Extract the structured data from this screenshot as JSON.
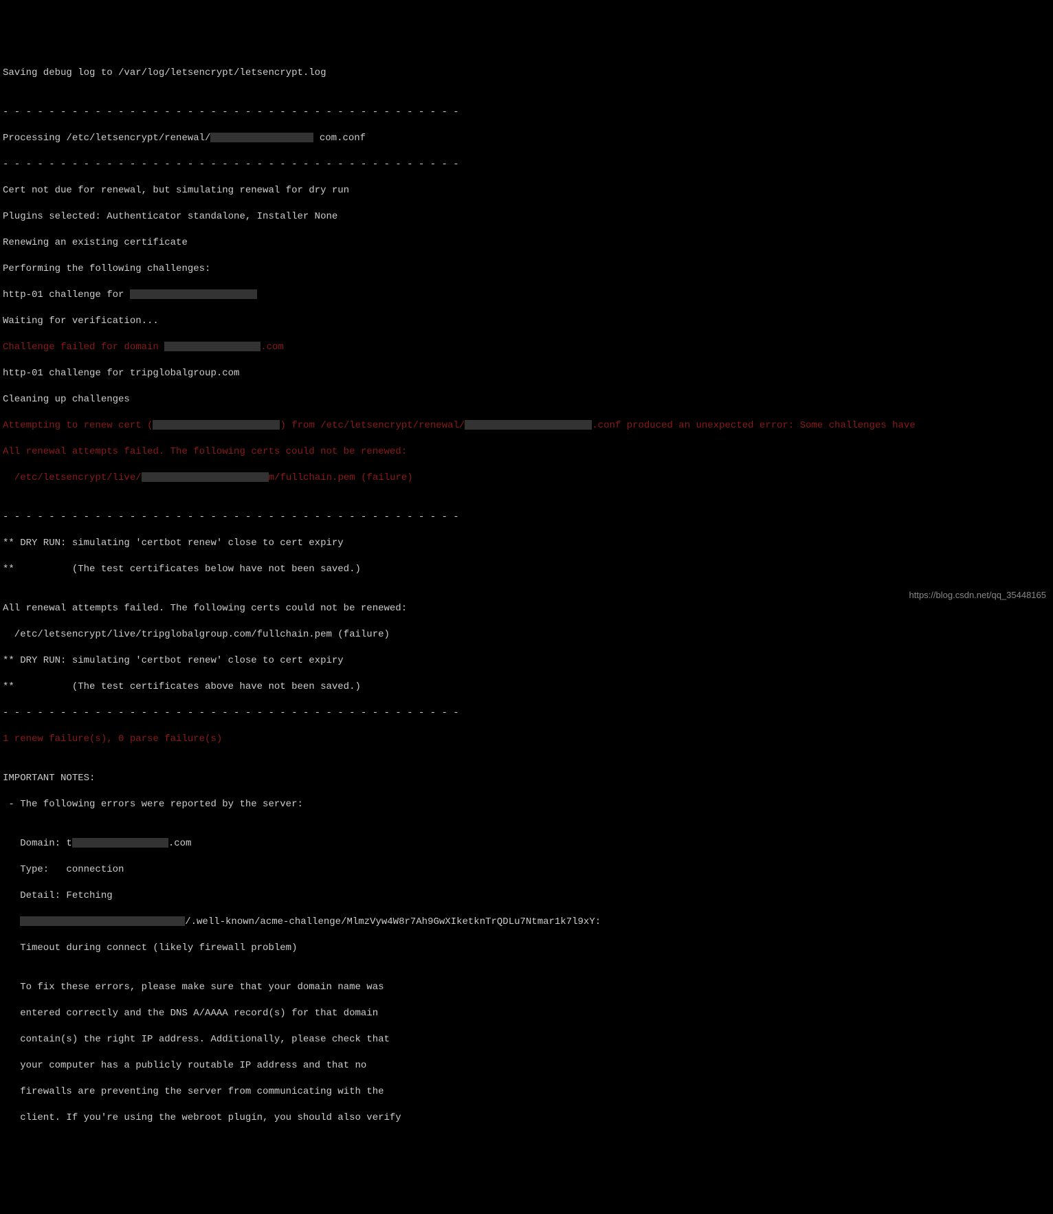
{
  "terminal": {
    "line_01": "Saving debug log to /var/log/letsencrypt/letsencrypt.log",
    "line_02": "",
    "divider": "- - - - - - - - - - - - - - - - - - - - - - - - - - - - - - - - - - - - - - - -",
    "line_04a": "Processing /etc/letsencrypt/renewal/",
    "line_04b": "com.conf",
    "line_06": "Cert not due for renewal, but simulating renewal for dry run",
    "line_07": "Plugins selected: Authenticator standalone, Installer None",
    "line_08": "Renewing an existing certificate",
    "line_09": "Performing the following challenges:",
    "line_10a": "http-01 challenge for ",
    "line_11": "Waiting for verification...",
    "line_12a": "Challenge failed for domain ",
    "line_12b": ".com",
    "line_13": "http-01 challenge for tripglobalgroup.com",
    "line_14": "Cleaning up challenges",
    "line_15a": "Attempting to renew cert (",
    "line_15b": ") from /etc/letsencrypt/renewal/",
    "line_15c": ".conf produced an unexpected error: Some challenges have",
    "line_16": "All renewal attempts failed. The following certs could not be renewed:",
    "line_17a": "  /etc/letsencrypt/live/",
    "line_17b": "m/fullchain.pem (failure)",
    "line_18": "",
    "line_20": "** DRY RUN: simulating 'certbot renew' close to cert expiry",
    "line_21": "**          (The test certificates below have not been saved.)",
    "line_22": "",
    "line_23": "All renewal attempts failed. The following certs could not be renewed:",
    "line_24": "  /etc/letsencrypt/live/tripglobalgroup.com/fullchain.pem (failure)",
    "line_25": "** DRY RUN: simulating 'certbot renew' close to cert expiry",
    "line_26": "**          (The test certificates above have not been saved.)",
    "line_28": "1 renew failure(s), 0 parse failure(s)",
    "line_29": "",
    "line_30": "IMPORTANT NOTES:",
    "line_31": " - The following errors were reported by the server:",
    "line_32": "",
    "line_33a": "   Domain: t",
    "line_33b": ".com",
    "line_34": "   Type:   connection",
    "line_35": "   Detail: Fetching",
    "line_36a": "   ",
    "line_36b": "/.well-known/acme-challenge/MlmzVyw4W8r7Ah9GwXIketknTrQDLu7Ntmar1k7l9xY:",
    "line_37": "   Timeout during connect (likely firewall problem)",
    "line_38": "",
    "line_39": "   To fix these errors, please make sure that your domain name was",
    "line_40": "   entered correctly and the DNS A/AAAA record(s) for that domain",
    "line_41": "   contain(s) the right IP address. Additionally, please check that",
    "line_42": "   your computer has a publicly routable IP address and that no",
    "line_43": "   firewalls are preventing the server from communicating with the",
    "line_44": "   client. If you're using the webroot plugin, you should also verify"
  },
  "watermark": "https://blog.csdn.net/qq_35448165"
}
